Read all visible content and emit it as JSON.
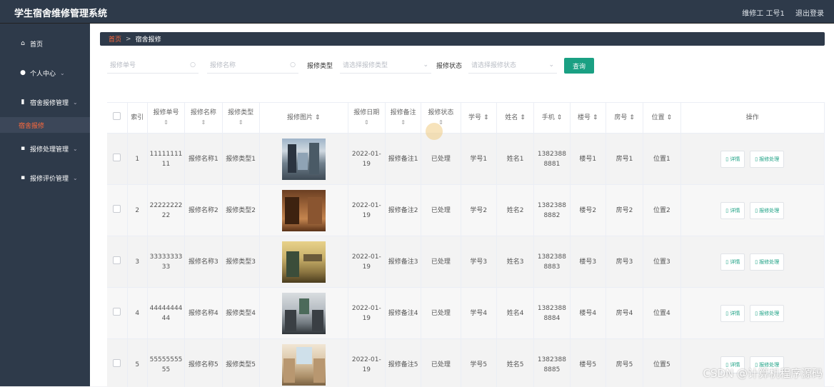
{
  "app": {
    "title": "学生宿舍维修管理系统"
  },
  "header": {
    "user": "维修工 工号1",
    "logout": "退出登录"
  },
  "sidebar": {
    "items": [
      {
        "label": "首页",
        "icon": "home-icon"
      },
      {
        "label": "个人中心",
        "icon": "user-icon"
      },
      {
        "label": "宿舍报修管理",
        "icon": "chart-icon"
      },
      {
        "label": "宿舍报修",
        "icon": ""
      },
      {
        "label": "报修处理管理",
        "icon": "clipboard-icon"
      },
      {
        "label": "报修评价管理",
        "icon": "clipboard-icon"
      }
    ]
  },
  "breadcrumb": {
    "home": "首页",
    "current": "宿舍报修"
  },
  "search": {
    "repair_no_placeholder": "报修单号",
    "repair_name_placeholder": "报修名称",
    "type_label": "报修类型",
    "type_placeholder": "请选择报修类型",
    "status_label": "报修状态",
    "status_placeholder": "请选择报修状态",
    "query_button": "查询"
  },
  "table": {
    "headers": [
      "索引",
      "报修单号",
      "报修名称",
      "报修类型",
      "报修图片",
      "报修日期",
      "报修备注",
      "报修状态",
      "学号",
      "姓名",
      "手机",
      "楼号",
      "房号",
      "位置",
      "操作"
    ],
    "rows": [
      {
        "index": "1",
        "no": "1111111111",
        "name": "报修名称1",
        "type": "报修类型1",
        "date": "2022-01-19",
        "note": "报修备注1",
        "status": "已处理",
        "sid": "学号1",
        "sname": "姓名1",
        "phone": "13823888881",
        "building": "楼号1",
        "room": "房号1",
        "position": "位置1"
      },
      {
        "index": "2",
        "no": "2222222222",
        "name": "报修名称2",
        "type": "报修类型2",
        "date": "2022-01-19",
        "note": "报修备注2",
        "status": "已处理",
        "sid": "学号2",
        "sname": "姓名2",
        "phone": "13823888882",
        "building": "楼号2",
        "room": "房号2",
        "position": "位置2"
      },
      {
        "index": "3",
        "no": "3333333333",
        "name": "报修名称3",
        "type": "报修类型3",
        "date": "2022-01-19",
        "note": "报修备注3",
        "status": "已处理",
        "sid": "学号3",
        "sname": "姓名3",
        "phone": "13823888883",
        "building": "楼号3",
        "room": "房号3",
        "position": "位置3"
      },
      {
        "index": "4",
        "no": "4444444444",
        "name": "报修名称4",
        "type": "报修类型4",
        "date": "2022-01-19",
        "note": "报修备注4",
        "status": "已处理",
        "sid": "学号4",
        "sname": "姓名4",
        "phone": "13823888884",
        "building": "楼号4",
        "room": "房号4",
        "position": "位置4"
      },
      {
        "index": "5",
        "no": "5555555555",
        "name": "报修名称5",
        "type": "报修类型5",
        "date": "2022-01-19",
        "note": "报修备注5",
        "status": "已处理",
        "sid": "学号5",
        "sname": "姓名5",
        "phone": "13823888885",
        "building": "楼号5",
        "room": "房号5",
        "position": "位置5"
      }
    ],
    "detail_button": "详情",
    "process_button": "报修处理"
  },
  "watermark": "CSDN @计算机程序源码",
  "colors": {
    "accent": "#1aa083",
    "active": "#ff6a3c",
    "dark": "#2e3a4a"
  }
}
